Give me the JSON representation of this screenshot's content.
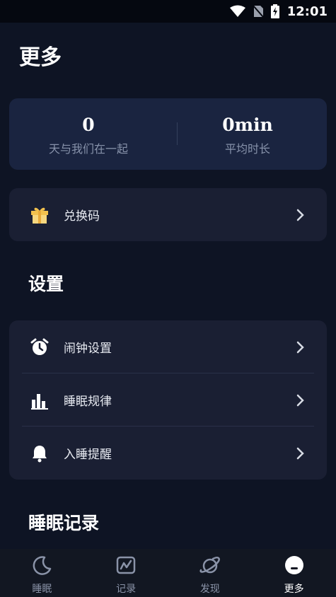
{
  "status": {
    "time": "12:01"
  },
  "page": {
    "title": "更多"
  },
  "stats": {
    "days_value": "0",
    "days_label": "天与我们在一起",
    "avg_value": "0min",
    "avg_label": "平均时长"
  },
  "redeem": {
    "label": "兑换码"
  },
  "settings": {
    "title": "设置",
    "items": [
      {
        "label": "闹钟设置"
      },
      {
        "label": "睡眠规律"
      },
      {
        "label": "入睡提醒"
      }
    ]
  },
  "records": {
    "title": "睡眠记录"
  },
  "nav": {
    "items": [
      {
        "label": "睡眠"
      },
      {
        "label": "记录"
      },
      {
        "label": "发现"
      },
      {
        "label": "更多"
      }
    ],
    "active": "更多"
  },
  "colors": {
    "background": "#0e1424",
    "card": "#1a1f33",
    "stats_card": "#1a2440",
    "gift_icon": "#f2c14e"
  }
}
